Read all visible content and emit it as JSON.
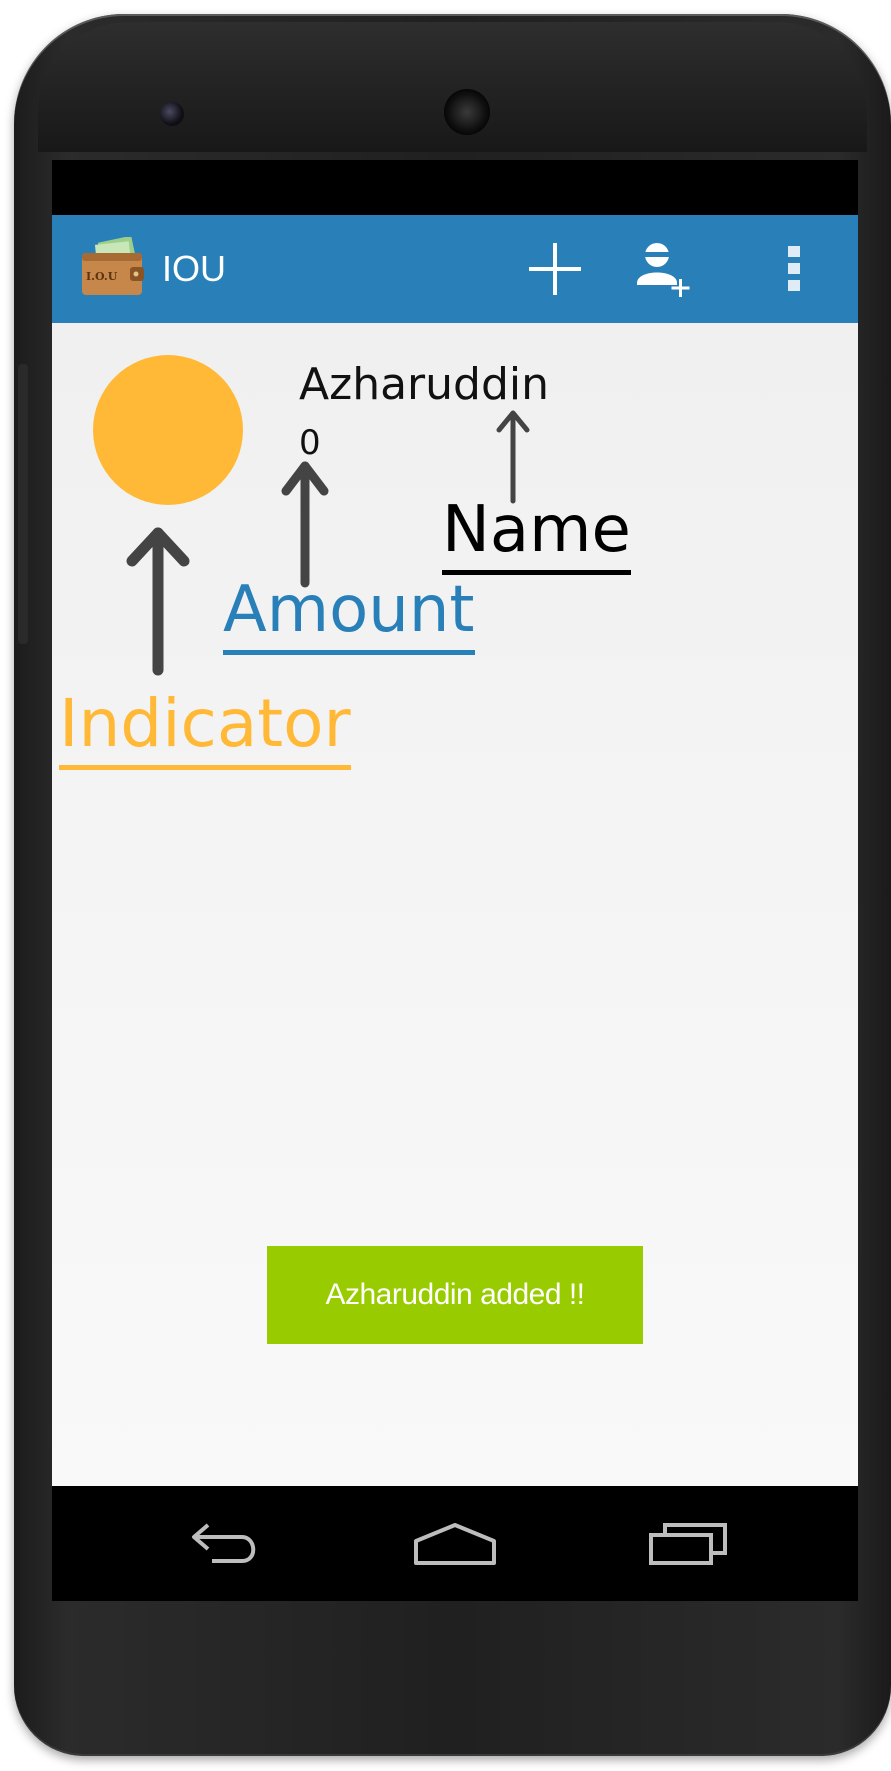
{
  "app": {
    "title": "IOU",
    "icon": "wallet-iou-icon"
  },
  "action_bar": {
    "color": "#2980b9",
    "actions": [
      {
        "icon": "plus-icon",
        "name": "add"
      },
      {
        "icon": "add-person-icon",
        "name": "add-person"
      },
      {
        "icon": "overflow-menu-icon",
        "name": "more"
      }
    ]
  },
  "entry": {
    "name": "Azharuddin",
    "amount": "0",
    "indicator_color": "#ffb937"
  },
  "annotations": {
    "name_label": "Name",
    "amount_label": "Amount",
    "indicator_label": "Indicator"
  },
  "toast": {
    "message": "Azharuddin added !!",
    "color": "#99cc00"
  },
  "navigation": {
    "buttons": [
      "back-icon",
      "home-icon",
      "recent-apps-icon"
    ]
  }
}
